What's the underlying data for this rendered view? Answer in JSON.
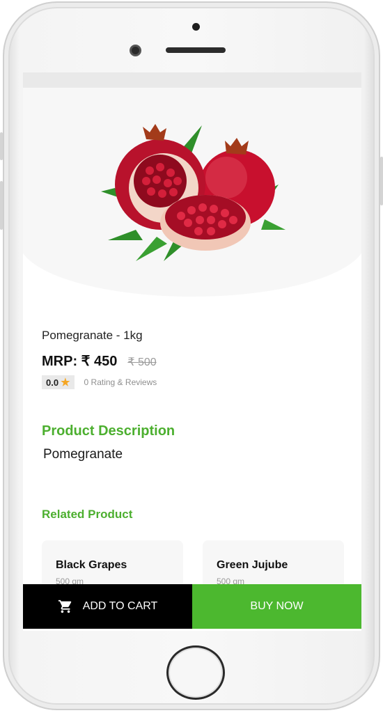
{
  "product": {
    "image_alt": "pomegranate",
    "title": "Pomegranate - 1kg",
    "price": "MRP: ₹ 450",
    "mrp_old": "₹ 500",
    "rating": "0.0",
    "rating_text": "0 Rating & Reviews"
  },
  "description": {
    "heading": "Product Description",
    "text": "Pomegranate"
  },
  "related": {
    "heading": "Related Product",
    "items": [
      {
        "name": "Black Grapes",
        "qty": "500 gm"
      },
      {
        "name": "Green Jujube",
        "qty": "500 gm"
      }
    ]
  },
  "actions": {
    "add_to_cart": "ADD TO CART",
    "buy_now": "BUY NOW"
  },
  "colors": {
    "accent_green": "#4caf2f",
    "buy_button": "#4cb82f",
    "cart_button": "#000000",
    "star": "#f5a623"
  },
  "icons": [
    "cart-icon",
    "star-icon"
  ]
}
